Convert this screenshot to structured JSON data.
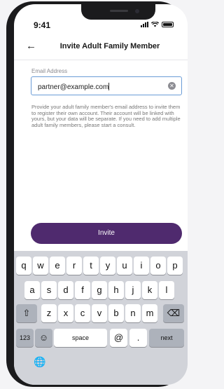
{
  "status_bar": {
    "time": "9:41"
  },
  "nav": {
    "back_icon": "←",
    "title": "Invite Adult Family Member"
  },
  "form": {
    "email_label": "Email Address",
    "email_value": "partner@example.com",
    "clear_icon": "✕",
    "helper_text": "Provide your adult family member's email address to invite them to register their own account. Their account will be linked with yours, but your data will be separate. If you need to add multiple adult family members, please start a consult."
  },
  "invite_button": {
    "label": "Invite"
  },
  "keyboard": {
    "row1": [
      "q",
      "w",
      "e",
      "r",
      "t",
      "y",
      "u",
      "i",
      "o",
      "p"
    ],
    "row2": [
      "a",
      "s",
      "d",
      "f",
      "g",
      "h",
      "j",
      "k",
      "l"
    ],
    "row3": [
      "z",
      "x",
      "c",
      "v",
      "b",
      "n",
      "m"
    ],
    "shift_icon": "⇧",
    "backspace_icon": "⌫",
    "numbers_label": "123",
    "emoji_icon": "☺",
    "space_label": "space",
    "at_label": "@",
    "dot_label": ".",
    "next_label": "next",
    "globe_icon": "🌐"
  }
}
